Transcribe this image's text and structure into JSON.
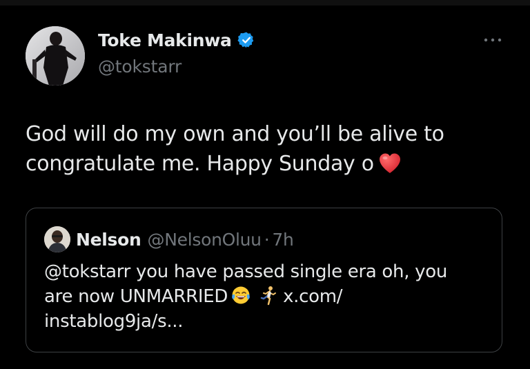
{
  "tweet": {
    "author": {
      "display_name": "Toke Makinwa",
      "handle": "@tokstarr",
      "verified": true
    },
    "text_line1": "God will do my own and you’ll be alive to",
    "text_line2": "congratulate me. Happy Sunday o",
    "emoji": "heart-emoji",
    "more_icon": "more-horizontal-icon"
  },
  "quote": {
    "author": {
      "display_name": "Nelson",
      "handle": "@NelsonOluu",
      "separator": "·",
      "time": "7h"
    },
    "text_line1": "@tokstarr you have passed single era oh, you",
    "text_line2_part1": "are now UNMARRIED",
    "emoji1": "tears-of-joy-emoji",
    "emoji2": "running-person-emoji",
    "text_line2_part2": "x.com/",
    "text_line3": "instablog9ja/s..."
  },
  "colors": {
    "background": "#000000",
    "primary_text": "#e7e9ea",
    "secondary_text": "#71767b",
    "verified_blue": "#1d9bf0",
    "border": "#3e4144",
    "heart_red": "#e0303a"
  }
}
